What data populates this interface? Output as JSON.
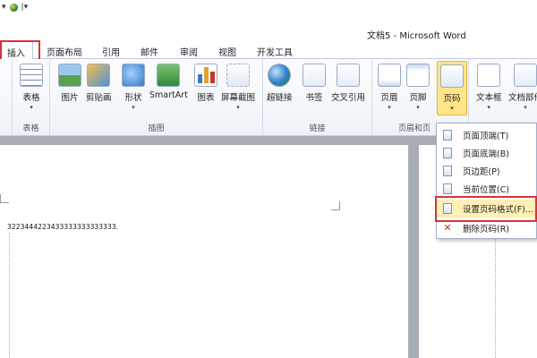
{
  "window": {
    "title": "文档5 - Microsoft Word",
    "qat_undo": "▾",
    "qat_customize": "|▾"
  },
  "tabs": [
    {
      "label": "插入",
      "active": true
    },
    {
      "label": "页面布局"
    },
    {
      "label": "引用"
    },
    {
      "label": "邮件"
    },
    {
      "label": "审阅"
    },
    {
      "label": "视图"
    },
    {
      "label": "开发工具"
    }
  ],
  "ribbon": {
    "groups": [
      {
        "label": ""
      },
      {
        "label": "表格"
      },
      {
        "label": "插图"
      },
      {
        "label": "链接"
      },
      {
        "label": "页眉和页"
      }
    ],
    "buttons": {
      "table": "表格",
      "picture": "图片",
      "clipart": "剪贴画",
      "shapes": "形状",
      "smartart": "SmartArt",
      "chart": "图表",
      "screenshot": "屏幕截图",
      "hyperlink": "超链接",
      "bookmark": "书签",
      "crossref": "交叉引用",
      "header": "页眉",
      "footer": "页脚",
      "pagenumber": "页码",
      "textbox": "文本框",
      "quickparts": "文档部件",
      "dropdown_arrow": "▾"
    }
  },
  "document": {
    "text": "3223444223433333333333333."
  },
  "pagenumber_menu": {
    "items": [
      {
        "label": "页面顶端(T)"
      },
      {
        "label": "页面底端(B)"
      },
      {
        "label": "页边距(P)"
      },
      {
        "label": "当前位置(C)"
      },
      {
        "label": "设置页码格式(F)...",
        "highlighted": true
      },
      {
        "label": "删除页码(R)"
      }
    ]
  },
  "colors": {
    "highlight_border": "#d8323a",
    "selected_button": "#ffe48a",
    "menu_hover": "#fff0b5"
  }
}
